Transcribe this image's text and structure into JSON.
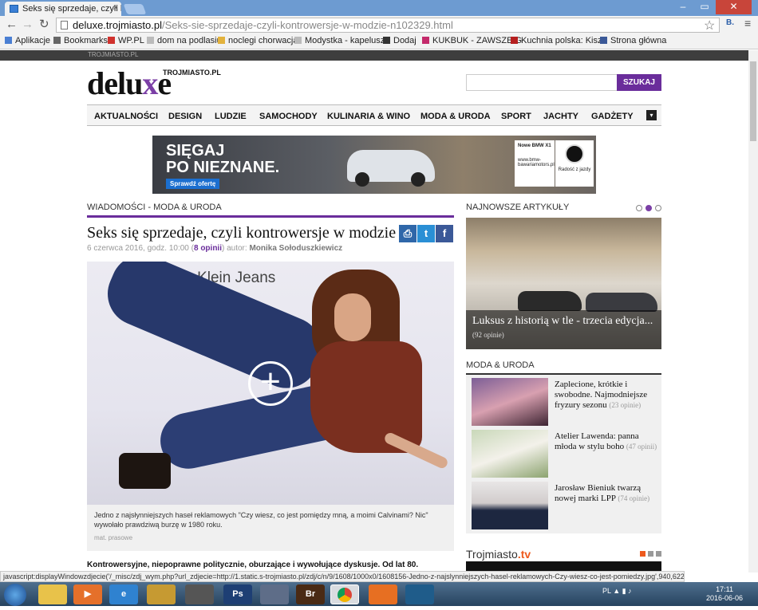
{
  "browser": {
    "tab_title": "Seks się sprzedaje, czyli ko",
    "url_host": "deluxe.trojmiasto.pl",
    "url_path": "/Seks-sie-sprzedaje-czyli-kontrowersje-w-modzie-n102329.html",
    "bookmarks": [
      "Aplikacje",
      "Bookmarks",
      "WP.PL",
      "dom na podlasiu",
      "noclegi chorwacja",
      "Modystka - kapelusze",
      "Dodaj",
      "KUKBUK - ZAWSZE G",
      "Kuchnia polska: Kiszk",
      "Strona główna"
    ],
    "status_text": "javascript:displayWindowzdjecie('/_misc/zdj_wym.php?url_zdjecie=http://1.static.s-trojmiasto.pl/zdj/c/n/9/1608/1000x0/1608156-Jedno-z-najslynniejszych-hasel-reklamowych-Czy-wiesz-co-jest-pomiedzy.jpg',940,622)"
  },
  "site": {
    "topstrip": "TROJMIASTO.PL",
    "logo_word_a": "delu",
    "logo_word_x": "x",
    "logo_word_b": "e",
    "logo_sub": "TROJMIASTO.PL",
    "search_button": "SZUKAJ",
    "menu": [
      "AKTUALNOŚCI",
      "DESIGN",
      "LUDZIE",
      "SAMOCHODY",
      "KULINARIA & WINO",
      "MODA & URODA",
      "SPORT",
      "JACHTY",
      "GADŻETY"
    ]
  },
  "ad": {
    "headline_1": "SIĘGAJ",
    "headline_2": "PO NIEZNANE.",
    "cta": "Sprawdź ofertę",
    "card_title": "Nowe BMW X1",
    "card_url": "www.bmw-bawariamotors.pl",
    "card2_text": "Radość z jazdy"
  },
  "article": {
    "breadcrumb": "WIADOMOŚCI - MODA & URODA",
    "title": "Seks się sprzedaje, czyli kontrowersje w modzie",
    "date": "6 czerwca 2016, godz. 10:00 (",
    "comments": "8 opinii",
    "author_label": ") autor:",
    "author": "Monika Sołoduszkiewicz",
    "photo_brand": "Calvin Klein Jeans",
    "caption": "Jedno z najsłynniejszych haseł reklamowych \"Czy wiesz, co jest pomiędzy mną, a moimi Calvinami? Nic\" wywołało prawdziwą burzę w 1980 roku.",
    "caption_source": "mat. prasowe",
    "lead": "Kontrowersyjne, niepoprawne politycznie, oburzające i wywołujące dyskusje. Od lat 80."
  },
  "sidebar": {
    "newest_header": "NAJNOWSZE ARTYKUŁY",
    "featured_title": "Luksus z historią w tle - trzecia edycja...",
    "featured_count": "(92 opinie)",
    "moda_header": "MODA & URODA",
    "moda_items": [
      {
        "title": "Zaplecione, krótkie i swobodne. Najmodniejsze fryzury sezonu",
        "count": "(23 opinie)"
      },
      {
        "title": "Atelier Lawenda: panna młoda w stylu boho",
        "count": "(47 opinii)"
      },
      {
        "title": "Jarosław Bieniuk twarzą nowej marki LPP",
        "count": "(74 opinie)"
      }
    ],
    "tv_logo": "Trojmiasto",
    "tv_suffix": ".tv"
  },
  "taskbar": {
    "lang": "PL",
    "time": "17:11",
    "date": "2016-06-06"
  },
  "colors": {
    "accent": "#6a2d9b",
    "tv_orange": "#ee5a1d"
  }
}
